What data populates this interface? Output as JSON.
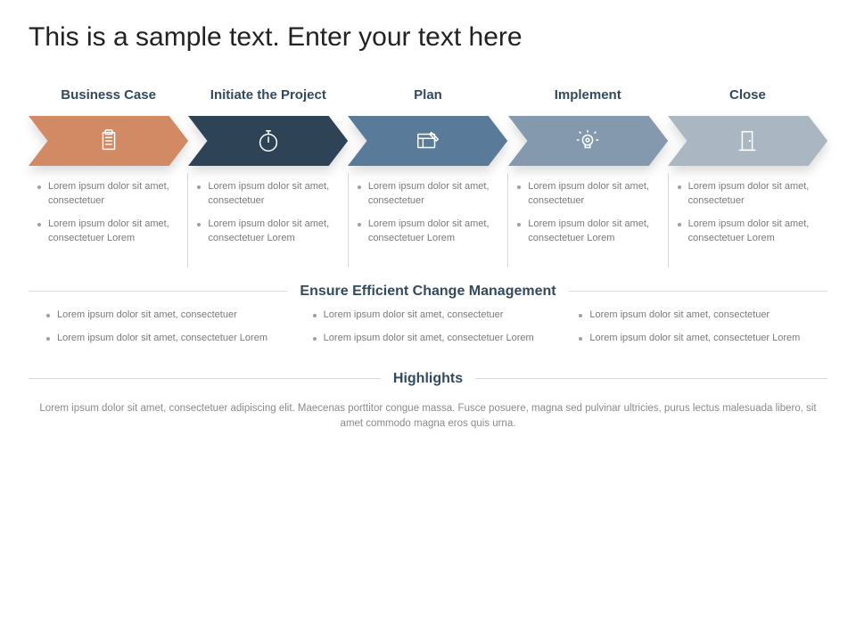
{
  "title": "This is a sample text. Enter your text here",
  "stages": [
    {
      "label": "Business Case",
      "color": "#d18a63",
      "icon": "clipboard",
      "bullets": [
        "Lorem ipsum dolor sit amet, consectetuer",
        "Lorem ipsum dolor sit amet, consectetuer Lorem"
      ]
    },
    {
      "label": "Initiate the Project",
      "color": "#2f4356",
      "icon": "stopwatch",
      "bullets": [
        "Lorem ipsum dolor sit amet, consectetuer",
        "Lorem ipsum dolor sit amet, consectetuer Lorem"
      ]
    },
    {
      "label": "Plan",
      "color": "#5a7a99",
      "icon": "plan-board",
      "bullets": [
        "Lorem ipsum dolor sit amet, consectetuer",
        "Lorem ipsum dolor sit amet, consectetuer Lorem"
      ]
    },
    {
      "label": "Implement",
      "color": "#8499ad",
      "icon": "lightbulb",
      "bullets": [
        "Lorem ipsum dolor sit amet, consectetuer",
        "Lorem ipsum dolor sit amet, consectetuer Lorem"
      ]
    },
    {
      "label": "Close",
      "color": "#aab7c2",
      "icon": "door",
      "bullets": [
        "Lorem ipsum dolor sit amet, consectetuer",
        "Lorem ipsum dolor sit amet, consectetuer Lorem"
      ]
    }
  ],
  "change": {
    "title": "Ensure Efficient Change Management",
    "columns": [
      [
        "Lorem ipsum dolor sit amet, consectetuer",
        "Lorem ipsum dolor sit amet, consectetuer Lorem"
      ],
      [
        "Lorem ipsum dolor sit amet, consectetuer",
        "Lorem ipsum dolor sit amet, consectetuer Lorem"
      ],
      [
        "Lorem ipsum dolor sit amet, consectetuer",
        "Lorem ipsum dolor sit amet, consectetuer Lorem"
      ]
    ]
  },
  "highlights": {
    "title": "Highlights",
    "text": "Lorem ipsum dolor sit amet, consectetuer adipiscing elit. Maecenas porttitor congue massa. Fusce posuere, magna sed pulvinar ultricies, purus lectus malesuada libero, sit amet commodo magna eros quis urna."
  }
}
